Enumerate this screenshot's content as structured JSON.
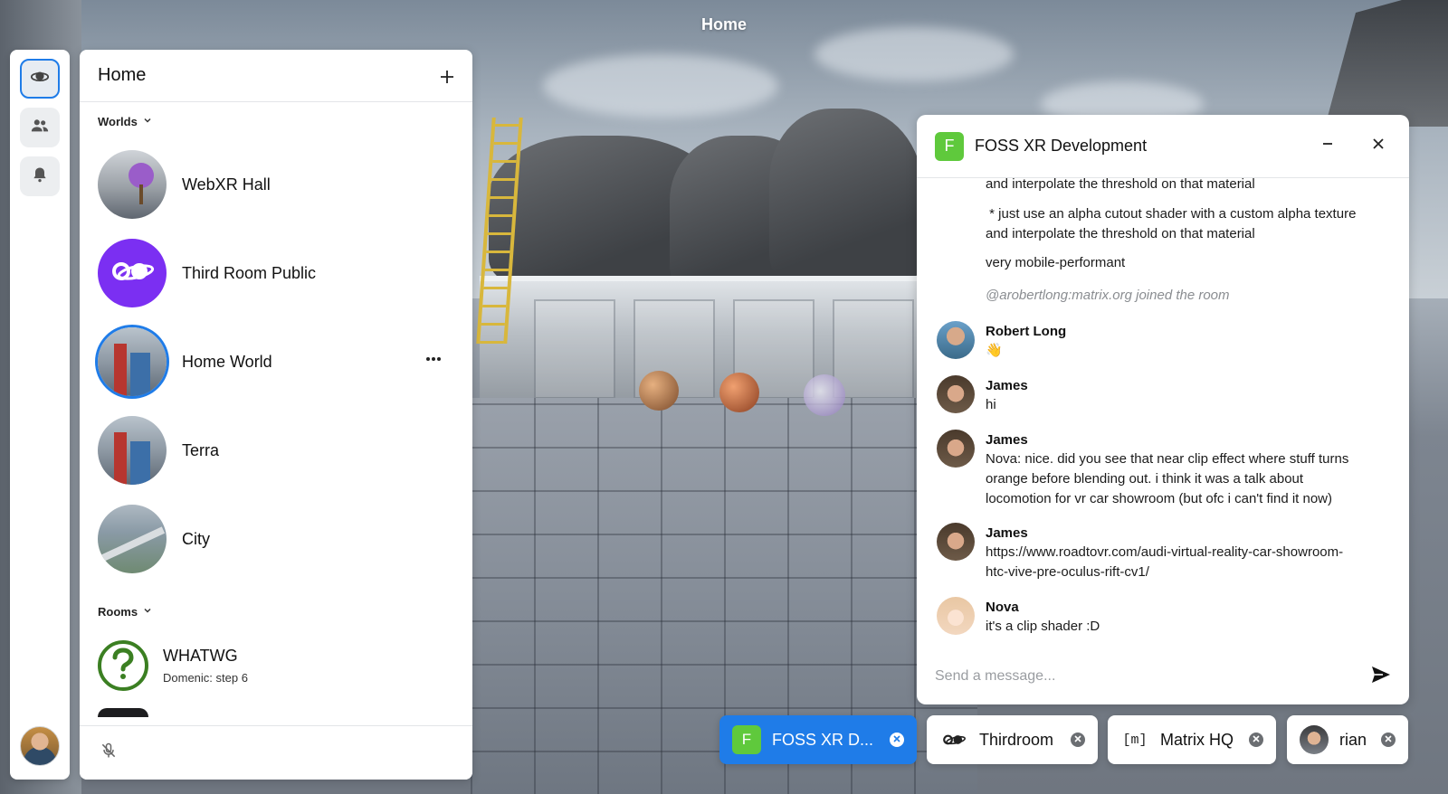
{
  "window": {
    "title": "Home"
  },
  "home_panel": {
    "title": "Home",
    "add_icon": "plus-icon",
    "worlds_section": "Worlds",
    "worlds": [
      {
        "label": "WebXR Hall"
      },
      {
        "label": "Third Room Public"
      },
      {
        "label": "Home World",
        "selected": true
      },
      {
        "label": "Terra"
      },
      {
        "label": "City"
      }
    ],
    "rooms_section": "Rooms",
    "rooms": [
      {
        "label": "WHATWG",
        "subtitle": "Domenic: step 6"
      }
    ],
    "footer_icon": "mic-muted-icon"
  },
  "rail": {
    "items": [
      {
        "icon": "planet-icon",
        "active": true
      },
      {
        "icon": "people-icon"
      },
      {
        "icon": "bell-icon"
      }
    ]
  },
  "chat": {
    "room_initial": "F",
    "room_color": "#5fc93c",
    "title": "FOSS XR Development",
    "messages": {
      "m0": "and interpolate the threshold on that material",
      "m1a": " * just use an alpha cutout shader with a custom alpha texture",
      "m1b": "and interpolate the threshold on that material",
      "m2": "very mobile-performant",
      "system": "@arobertlong:matrix.org joined the room",
      "m3_sender": "Robert Long",
      "m3_text": "👋",
      "m4_sender": "James",
      "m4_text": "hi",
      "m5_sender": "James",
      "m5_l1": "Nova: nice. did you see that near clip effect where stuff turns",
      "m5_l2": "orange before blending out. i think it was a talk about",
      "m5_l3": "locomotion for vr car showroom (but ofc i can't find it now)",
      "m6_sender": "James",
      "m6_l1": "https://www.roadtovr.com/audi-virtual-reality-car-showroom-",
      "m6_l2": "htc-vive-pre-oculus-rift-cv1/",
      "m7_sender": "Nova",
      "m7_text": "it's a clip shader :D"
    },
    "composer_placeholder": "Send a message..."
  },
  "tabs": [
    {
      "label": "FOSS XR D...",
      "initial": "F",
      "active": true
    },
    {
      "label": "Thirdroom",
      "icon": "thirdroom-logo-icon"
    },
    {
      "label": "Matrix HQ",
      "icon_text": "[m]"
    },
    {
      "label": "rian",
      "icon": "avatar"
    }
  ],
  "colors": {
    "accent": "#1f7ce8",
    "thirdroom_purple": "#7b2ff2",
    "room_green": "#5fc93c"
  }
}
